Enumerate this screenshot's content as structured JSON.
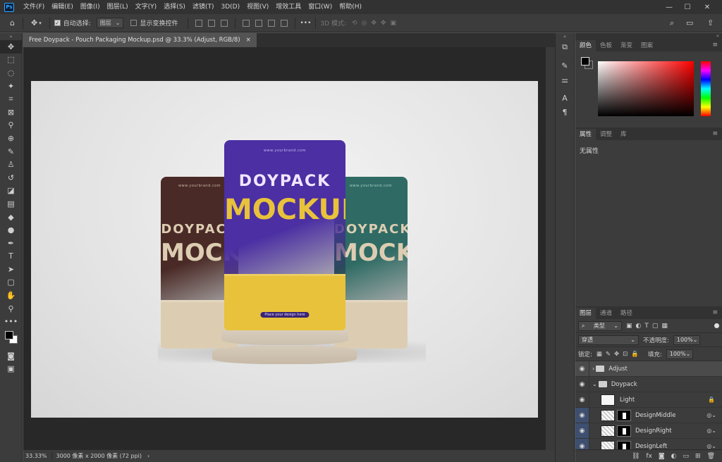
{
  "app": {
    "logo": "Ps"
  },
  "menu": [
    "文件(F)",
    "编辑(E)",
    "图像(I)",
    "图层(L)",
    "文字(Y)",
    "选择(S)",
    "滤镜(T)",
    "3D(D)",
    "视图(V)",
    "增效工具",
    "窗口(W)",
    "帮助(H)"
  ],
  "window_controls": {
    "minimize": "—",
    "maximize": "☐",
    "close": "✕"
  },
  "options": {
    "auto_select_label": "自动选择:",
    "auto_select_value": "图层",
    "show_transform_label": "显示变换控件",
    "mode_3d_label": "3D 模式:",
    "more": "•••"
  },
  "document": {
    "tab_title": "Free Doypack - Pouch Packaging Mockup.psd @ 33.3% (Adjust, RGB/8)",
    "close": "×"
  },
  "status": {
    "zoom": "33.33%",
    "info": "3000 像素 x 2000 像素 (72 ppi)"
  },
  "mockup": {
    "brand": "www.yourbrand.com",
    "line1": "DOYPACK",
    "line2": "MOCKUP",
    "tagline": "Place your design here",
    "colors": {
      "center": "#4b2fa3",
      "accent": "#e8c23a",
      "left": "#4a2a26",
      "right": "#2f6b64",
      "cream": "#dccdb2"
    }
  },
  "color_panel": {
    "tabs": [
      "颜色",
      "色板",
      "渐变",
      "图案"
    ],
    "foreground": "#000000"
  },
  "properties_panel": {
    "tabs": [
      "属性",
      "调整",
      "库"
    ],
    "empty_text": "无属性"
  },
  "layers_panel": {
    "tabs": [
      "图层",
      "通道",
      "路径"
    ],
    "filter_kind": "类型",
    "blend_mode": "穿透",
    "opacity_label": "不透明度:",
    "opacity_value": "100%",
    "lock_label": "锁定:",
    "fill_label": "填充:",
    "fill_value": "100%",
    "layers": [
      {
        "name": "Adjust",
        "type": "group",
        "selected": true
      },
      {
        "name": "Doypack",
        "type": "group",
        "selected": false
      },
      {
        "name": "Light",
        "type": "layer",
        "selected": false
      },
      {
        "name": "DesignMiddle",
        "type": "smart",
        "selected": false
      },
      {
        "name": "DesignRight",
        "type": "smart",
        "selected": false
      },
      {
        "name": "DesignLeft",
        "type": "smart",
        "selected": false
      }
    ]
  }
}
